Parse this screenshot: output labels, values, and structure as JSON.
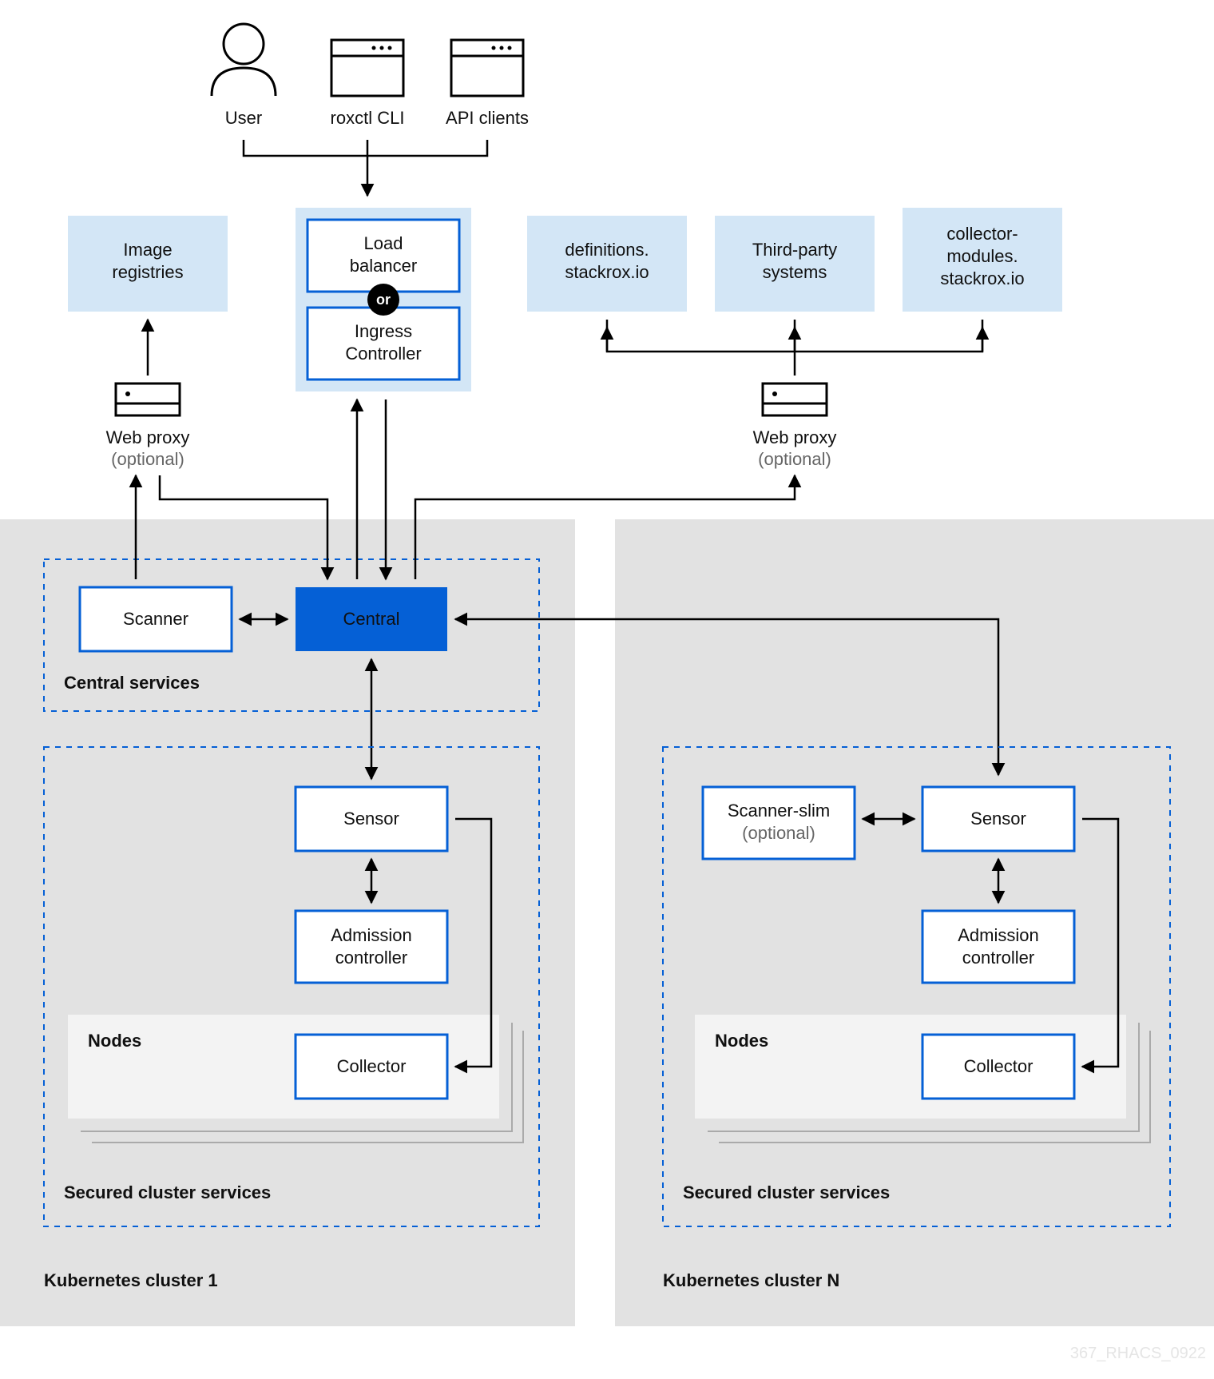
{
  "actors": {
    "user": "User",
    "roxctl": "roxctl CLI",
    "api": "API clients"
  },
  "top": {
    "image_registries": "Image\nregistries",
    "load_balancer": "Load\nbalancer",
    "ingress": "Ingress\nController",
    "or": "or",
    "definitions": "definitions.\nstackrox.io",
    "third_party": "Third-party\nsystems",
    "collector_modules": "collector-\nmodules.\nstackrox.io"
  },
  "proxy": {
    "left_label": "Web proxy",
    "left_sub": "(optional)",
    "right_label": "Web proxy",
    "right_sub": "(optional)"
  },
  "central_services": {
    "title": "Central services",
    "scanner": "Scanner",
    "central": "Central"
  },
  "cluster1": {
    "title": "Kubernetes cluster 1",
    "secured_title": "Secured cluster services",
    "sensor": "Sensor",
    "admission": "Admission\ncontroller",
    "nodes": "Nodes",
    "collector": "Collector"
  },
  "clusterN": {
    "title": "Kubernetes cluster N",
    "secured_title": "Secured cluster services",
    "scanner_slim": "Scanner-slim",
    "scanner_slim_sub": "(optional)",
    "sensor": "Sensor",
    "admission": "Admission\ncontroller",
    "nodes": "Nodes",
    "collector": "Collector"
  },
  "watermark": "367_RHACS_0922"
}
